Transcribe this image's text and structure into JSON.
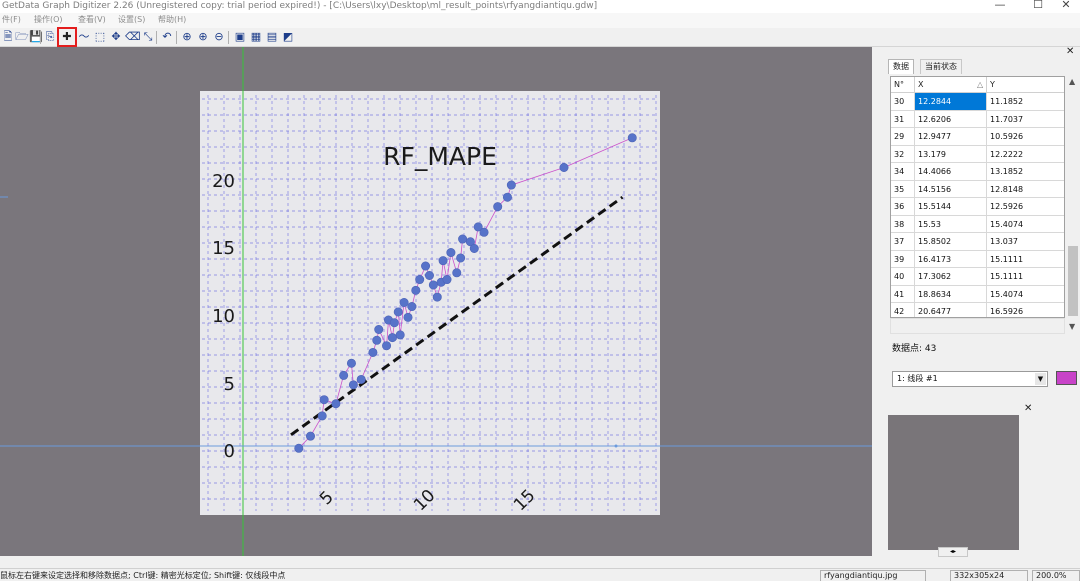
{
  "window": {
    "title": "GetData Graph Digitizer 2.26 (Unregistered copy: trial period expired!) - [C:\\Users\\lxy\\Desktop\\ml_result_points\\rfyangdiantiqu.gdw]",
    "minimize": "—",
    "maximize": "☐",
    "close": "✕"
  },
  "menu": [
    "件(F)",
    "操作(O)",
    "查看(V)",
    "设置(S)",
    "帮助(H)"
  ],
  "toolbar": {
    "icons": [
      "new-icon",
      "open-icon",
      "save-icon",
      "copy-icon",
      "digitize-points-icon",
      "auto-trace-line-icon",
      "area-digitize-icon",
      "move-icon",
      "eraser-icon",
      "rotate-icon",
      "undo-icon",
      "zoom-fit-icon",
      "zoom-in-icon",
      "zoom-out-icon",
      "image-icon",
      "grid-icon",
      "set-scale-icon",
      "options-icon"
    ],
    "glyphs": [
      "🗎",
      "🗁",
      "💾",
      "⎘",
      "✚",
      "〜",
      "⬚",
      "✥",
      "⌫",
      "⤡",
      "↶",
      "⊕",
      "⊕",
      "⊖",
      "▣",
      "▦",
      "▤",
      "◩"
    ]
  },
  "plot": {
    "title": "RF_MAPE",
    "yticks": [
      "20",
      "15",
      "10",
      "5",
      "0"
    ],
    "xticks": [
      "5",
      "10",
      "15"
    ]
  },
  "chart_data": {
    "type": "scatter",
    "title": "RF_MAPE",
    "xlabel": "",
    "ylabel": "",
    "xlim": [
      0,
      20
    ],
    "ylim": [
      0,
      23
    ],
    "grid": true,
    "x": [
      4.4,
      5.0,
      5.6,
      5.7,
      6.3,
      6.7,
      7.1,
      7.2,
      7.6,
      8.2,
      8.4,
      8.5,
      8.9,
      9.0,
      9.2,
      9.3,
      9.5,
      9.6,
      9.8,
      10.0,
      10.2,
      10.4,
      10.6,
      10.9,
      11.1,
      11.3,
      11.5,
      11.7,
      11.8,
      12.0,
      12.2,
      12.5,
      12.7,
      12.8,
      13.2,
      13.4,
      13.6,
      13.9,
      14.6,
      15.1,
      15.3,
      18.0,
      21.5
    ],
    "y": [
      0.2,
      1.1,
      2.6,
      3.8,
      3.5,
      5.6,
      6.5,
      4.9,
      5.3,
      7.3,
      8.2,
      9.0,
      7.8,
      9.7,
      8.4,
      9.5,
      10.3,
      8.6,
      11.0,
      9.9,
      10.7,
      11.9,
      12.7,
      13.7,
      13.0,
      12.3,
      11.4,
      12.5,
      14.1,
      12.7,
      14.7,
      13.2,
      14.3,
      15.7,
      15.5,
      15.0,
      16.6,
      16.2,
      18.1,
      18.8,
      19.7,
      21.0,
      23.2
    ]
  },
  "fit_line": {
    "x": [
      4.0,
      21.0
    ],
    "y": [
      1.2,
      18.8
    ]
  },
  "panel": {
    "tabs": [
      "数据",
      "当前状态"
    ],
    "columns": [
      "N°",
      "X",
      "Y"
    ],
    "sort_glyph": "△",
    "rows": [
      {
        "n": "30",
        "x": "12.2844",
        "y": "11.1852",
        "selected": true
      },
      {
        "n": "31",
        "x": "12.6206",
        "y": "11.7037"
      },
      {
        "n": "29",
        "x": "12.9477",
        "y": "10.5926"
      },
      {
        "n": "32",
        "x": "13.179",
        "y": "12.2222"
      },
      {
        "n": "34",
        "x": "14.4066",
        "y": "13.1852"
      },
      {
        "n": "35",
        "x": "14.5156",
        "y": "12.8148"
      },
      {
        "n": "36",
        "x": "15.5144",
        "y": "12.5926"
      },
      {
        "n": "38",
        "x": "15.53",
        "y": "15.4074"
      },
      {
        "n": "37",
        "x": "15.8502",
        "y": "13.037"
      },
      {
        "n": "39",
        "x": "16.4173",
        "y": "15.1111"
      },
      {
        "n": "40",
        "x": "17.3062",
        "y": "15.1111"
      },
      {
        "n": "41",
        "x": "18.8634",
        "y": "15.4074"
      },
      {
        "n": "42",
        "x": "20.6477",
        "y": "16.5926"
      }
    ],
    "count_label": "数据点: 43",
    "series_selected": "1: 线段 #1",
    "series_color": "#c843c8",
    "close_glyph": "✕"
  },
  "statusbar": {
    "hint": "鼠标左右键来设定选择和移除数据点; Ctrl键: 精密光标定位; Shift键: 仅线段中点",
    "filename": "rfyangdiantiqu.jpg",
    "dimensions": "332x305x24",
    "zoom": "200.0%"
  }
}
